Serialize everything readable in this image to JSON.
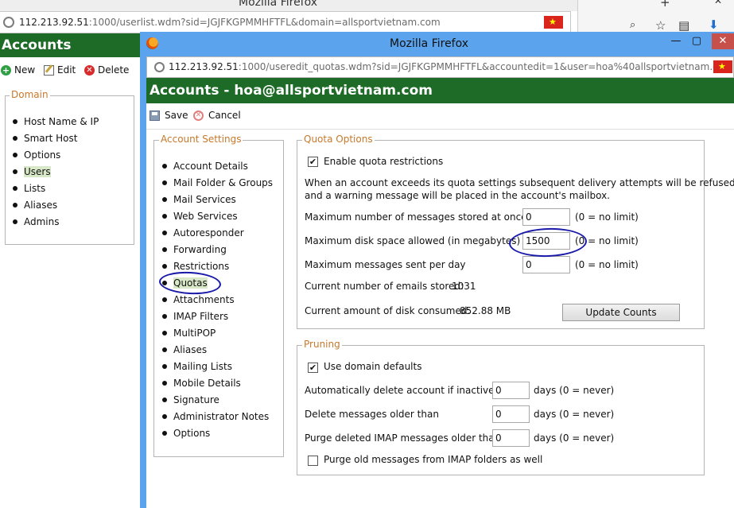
{
  "background_window": {
    "title": "Mozilla Firefox",
    "url_host": "112.213.92.51",
    "url_rest": ":1000/userlist.wdm?sid=JGJFKGPMMHFTFL&domain=allsportvietnam.com",
    "header_title": "Accounts",
    "toolbar": {
      "new_label": "New",
      "edit_label": "Edit",
      "delete_label": "Delete"
    },
    "domain_legend": "Domain",
    "domain_items": [
      {
        "label": "Host Name & IP"
      },
      {
        "label": "Smart Host"
      },
      {
        "label": "Options"
      },
      {
        "label": "Users",
        "selected": true
      },
      {
        "label": "Lists"
      },
      {
        "label": "Aliases"
      },
      {
        "label": "Admins"
      }
    ]
  },
  "popup_window": {
    "title": "Mozilla Firefox",
    "url_host": "112.213.92.51",
    "url_rest": ":1000/useredit_quotas.wdm?sid=JGJFKGPMMHFTFL&accountedit=1&user=hoa%40allsportvietnam.com",
    "header_title": "Accounts - hoa@allsportvietnam.com",
    "toolbar": {
      "save_label": "Save",
      "cancel_label": "Cancel"
    },
    "settings_legend": "Account Settings",
    "settings_items": [
      {
        "label": "Account Details"
      },
      {
        "label": "Mail Folder & Groups"
      },
      {
        "label": "Mail Services"
      },
      {
        "label": "Web Services"
      },
      {
        "label": "Autoresponder"
      },
      {
        "label": "Forwarding"
      },
      {
        "label": "Restrictions"
      },
      {
        "label": "Quotas",
        "selected": true
      },
      {
        "label": "Attachments"
      },
      {
        "label": "IMAP Filters"
      },
      {
        "label": "MultiPOP"
      },
      {
        "label": "Aliases"
      },
      {
        "label": "Mailing Lists"
      },
      {
        "label": "Mobile Details"
      },
      {
        "label": "Signature"
      },
      {
        "label": "Administrator Notes"
      },
      {
        "label": "Options"
      }
    ],
    "quota": {
      "legend": "Quota Options",
      "enable_label": "Enable quota restrictions",
      "enable_checked": true,
      "description_line1": "When an account exceeds its quota settings subsequent delivery attempts will be refused",
      "description_line2": "and a warning message will be placed in the account's mailbox.",
      "max_messages_label": "Maximum number of messages stored at once",
      "max_messages_value": "0",
      "max_disk_label": "Maximum disk space allowed (in megabytes)",
      "max_disk_value": "1500",
      "max_sent_label": "Maximum messages sent per day",
      "max_sent_value": "0",
      "no_limit_hint": "(0 = no limit)",
      "current_emails_label": "Current number of emails stored:",
      "current_emails_value": "1031",
      "current_disk_label": "Current amount of disk consumed:",
      "current_disk_value": "852.88 MB",
      "update_button": "Update Counts"
    },
    "pruning": {
      "legend": "Pruning",
      "domain_defaults_label": "Use domain defaults",
      "domain_defaults_checked": true,
      "inactive_label": "Automatically delete account if inactive for",
      "inactive_value": "0",
      "older_label": "Delete messages older than",
      "older_value": "0",
      "purge_label": "Purge deleted IMAP messages older than",
      "purge_value": "0",
      "days_hint": "days (0 = never)",
      "purge_old_label": "Purge old messages from IMAP folders as well",
      "purge_old_checked": false
    }
  }
}
